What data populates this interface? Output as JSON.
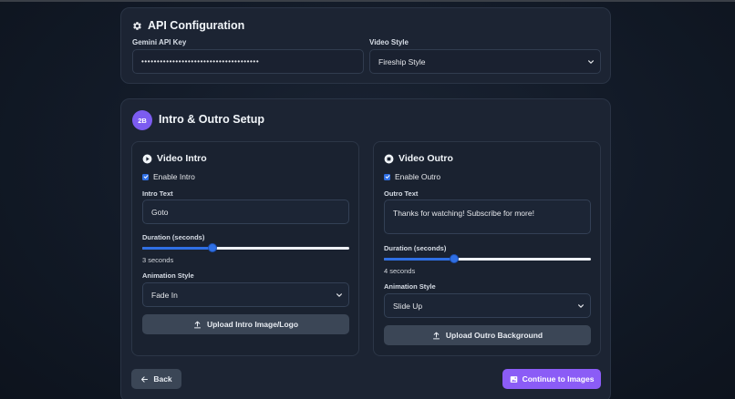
{
  "api_config": {
    "title": "API Configuration",
    "icon": "gear-icon",
    "gemini_label": "Gemini API Key",
    "gemini_value": "••••••••••••••••••••••••••••••••••••••",
    "style_label": "Video Style",
    "style_value": "Fireship Style"
  },
  "setup": {
    "step": "2B",
    "title": "Intro & Outro Setup",
    "intro": {
      "title": "Video Intro",
      "icon": "play-circle-icon",
      "enable_label": "Enable Intro",
      "enabled": true,
      "text_label": "Intro Text",
      "text_value": "Goto",
      "duration_label": "Duration (seconds)",
      "duration_fraction": 0.34,
      "duration_text": "3 seconds",
      "animation_label": "Animation Style",
      "animation_value": "Fade In",
      "upload_label": "Upload Intro Image/Logo"
    },
    "outro": {
      "title": "Video Outro",
      "icon": "stop-circle-icon",
      "enable_label": "Enable Outro",
      "enabled": true,
      "text_label": "Outro Text",
      "text_value": "Thanks for watching! Subscribe for more!",
      "duration_label": "Duration (seconds)",
      "duration_fraction": 0.34,
      "duration_text": "4 seconds",
      "animation_label": "Animation Style",
      "animation_value": "Slide Up",
      "upload_label": "Upload Outro Background"
    }
  },
  "nav": {
    "back_label": "Back",
    "continue_label": "Continue to Images"
  },
  "colors": {
    "accent": "#8b5cf6",
    "primary": "#2f6fe4",
    "card": "#1c2433"
  }
}
